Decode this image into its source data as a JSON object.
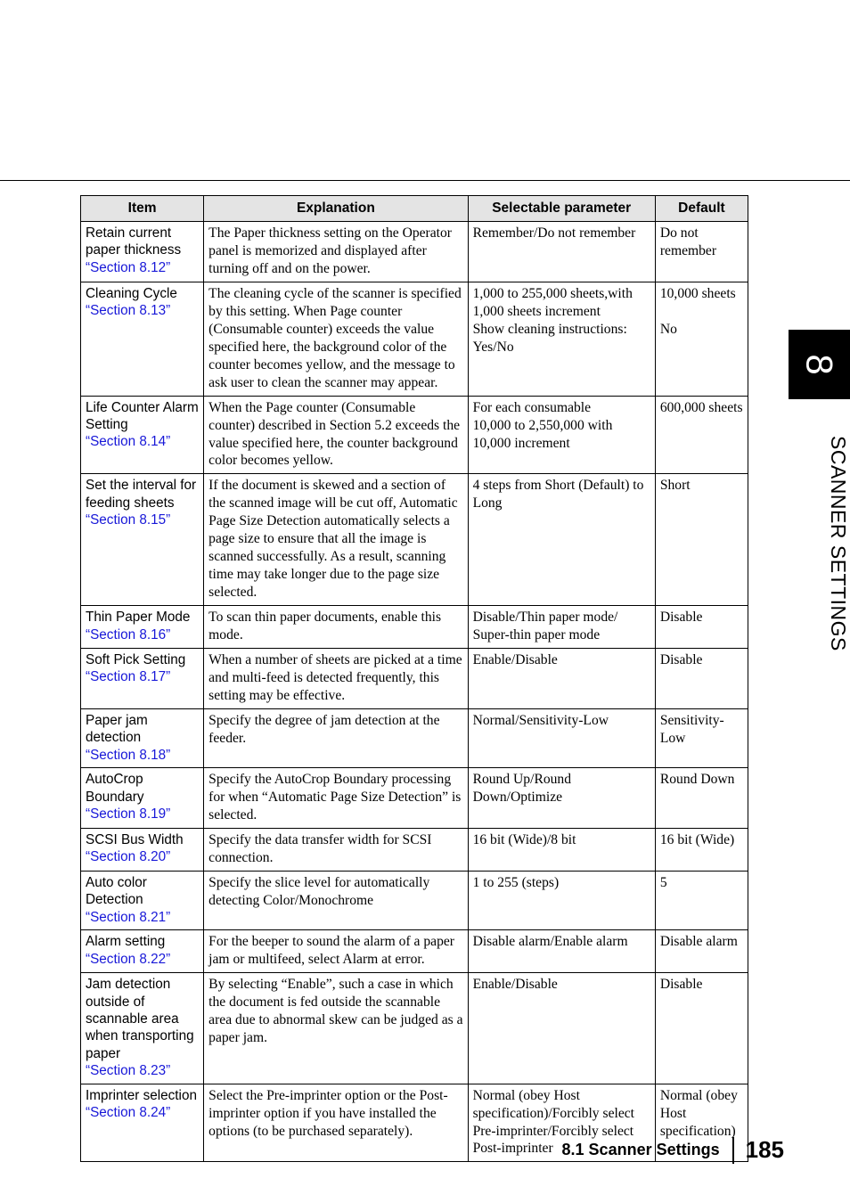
{
  "page": {
    "chapter_number": "8",
    "chapter_title": "SCANNER SETTINGS",
    "footer_section": "8.1 Scanner Settings",
    "page_number": "185",
    "link_color": "#1818d8",
    "header_bg": "#e4e4e4"
  },
  "table": {
    "headers": [
      "Item",
      "Explanation",
      "Selectable parameter",
      "Default"
    ],
    "rows": [
      {
        "item": "Retain current paper thickness",
        "ref": "“Section 8.12”",
        "explanation": "The Paper thickness setting on the Operator panel is memorized and displayed after turning off and on the power.",
        "parameter": "Remember/Do not remember",
        "default": "Do not remember"
      },
      {
        "item": "Cleaning Cycle",
        "ref": "“Section 8.13”",
        "explanation": "The cleaning cycle of the scanner is specified by this setting. When Page counter (Consumable counter) exceeds the value specified here, the background color of the counter becomes yellow, and the message to ask user to clean the scanner may appear.",
        "parameter": "1,000 to 255,000 sheets,with 1,000 sheets increment\nShow cleaning instructions: Yes/No",
        "default": "10,000 sheets\n\nNo"
      },
      {
        "item": "Life Counter Alarm Setting",
        "ref": "“Section 8.14”",
        "explanation": "When the Page counter (Consumable counter) described in Section 5.2 exceeds the value specified here, the counter background color becomes yellow.",
        "parameter": "For each consumable\n10,000 to 2,550,000 with 10,000 increment",
        "default": "600,000 sheets"
      },
      {
        "item": "Set the interval for feeding sheets",
        "ref": "“Section 8.15”",
        "explanation": "If the document is skewed and a section of the scanned image will be cut off, Automatic Page Size Detection automatically selects a page size to ensure that all the image is scanned successfully. As a result, scanning time may take longer due to the page size selected.",
        "parameter": "4 steps from Short (Default) to Long",
        "default": "Short"
      },
      {
        "item": "Thin Paper Mode",
        "ref": "“Section 8.16”",
        "explanation": "To scan thin paper documents, enable this mode.",
        "parameter": "Disable/Thin paper mode/ Super-thin paper mode",
        "default": "Disable"
      },
      {
        "item": "Soft Pick Setting",
        "ref": "“Section 8.17”",
        "explanation": "When a number of sheets are picked at a time and multi-feed is detected frequently, this setting may be effective.",
        "parameter": "Enable/Disable",
        "default": "Disable"
      },
      {
        "item": "Paper jam detection",
        "ref": "“Section 8.18”",
        "explanation": "Specify the degree of jam detection at the feeder.",
        "parameter": "Normal/Sensitivity-Low",
        "default": "Sensitivity-Low"
      },
      {
        "item": "AutoCrop Boundary",
        "ref": "“Section 8.19”",
        "explanation": "Specify the AutoCrop Boundary processing for when “Automatic Page Size Detection” is selected.",
        "parameter": "Round Up/Round Down/Optimize",
        "default": "Round Down"
      },
      {
        "item": "SCSI Bus Width",
        "ref": "“Section 8.20”",
        "explanation": "Specify the data transfer width for SCSI connection.",
        "parameter": "16 bit (Wide)/8 bit",
        "default": "16 bit (Wide)"
      },
      {
        "item": "Auto color Detection",
        "ref": "“Section 8.21”",
        "explanation": "Specify the slice level for automatically detecting Color/Monochrome",
        "parameter": "1 to 255 (steps)",
        "default": "5"
      },
      {
        "item": "Alarm setting",
        "ref": "“Section 8.22”",
        "explanation": "For the beeper to sound the alarm of a paper jam or multifeed, select Alarm at error.",
        "parameter": "Disable alarm/Enable alarm",
        "default": "Disable alarm"
      },
      {
        "item": "Jam detection outside of scannable area when transporting paper",
        "ref": "“Section 8.23”",
        "explanation": "By selecting “Enable”, such a case in which the document is fed outside the scannable area due to abnormal skew can be judged as a paper jam.",
        "parameter": "Enable/Disable",
        "default": "Disable"
      },
      {
        "item": "Imprinter selection",
        "ref": "“Section 8.24”",
        "explanation": "Select the Pre-imprinter option or the Post-imprinter option if you have installed the options (to be purchased separately).",
        "parameter": "Normal (obey Host specification)/Forcibly select Pre-imprinter/Forcibly select Post-imprinter",
        "default": "Normal (obey Host specification)"
      }
    ]
  }
}
